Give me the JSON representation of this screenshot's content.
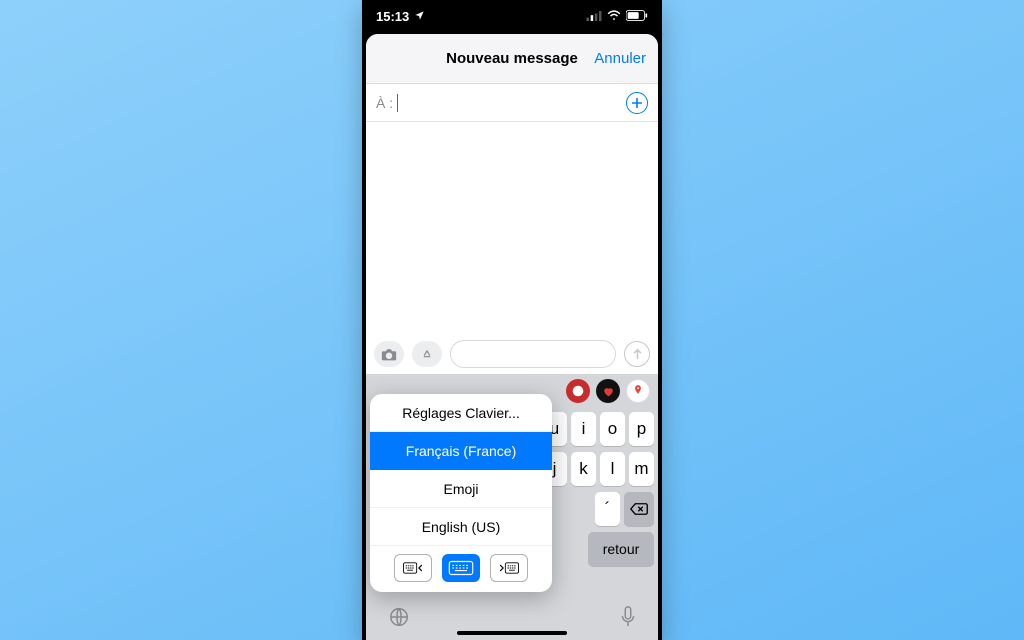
{
  "status": {
    "time": "15:13"
  },
  "nav": {
    "title": "Nouveau message",
    "cancel": "Annuler"
  },
  "compose": {
    "to_label": "À :"
  },
  "lang_menu": {
    "settings": "Réglages Clavier...",
    "options": [
      "Français (France)",
      "Emoji",
      "English (US)"
    ],
    "selected_index": 0
  },
  "keyboard": {
    "visible_row1": [
      "u",
      "i",
      "o",
      "p"
    ],
    "visible_row2": [
      "j",
      "k",
      "l",
      "m"
    ],
    "visible_row3": [
      "´"
    ],
    "return_label": "retour"
  },
  "colors": {
    "accent": "#007aff",
    "app_icons": [
      "#c82d2e",
      "#111111",
      "#ffffff"
    ]
  }
}
